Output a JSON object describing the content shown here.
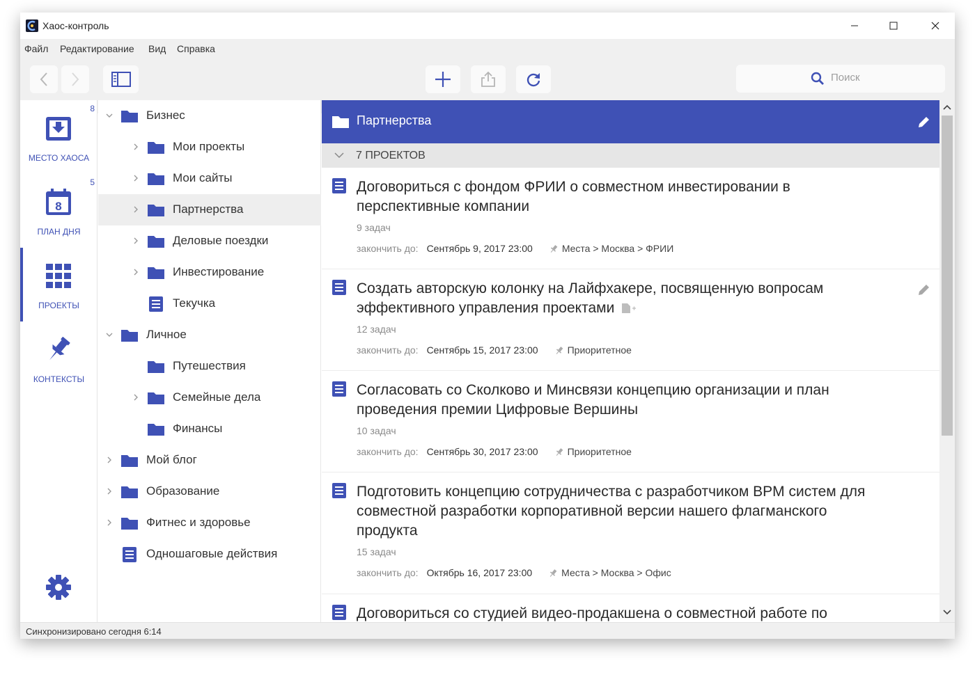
{
  "window": {
    "title": "Хаос-контроль"
  },
  "menu": [
    "Файл",
    "Редактирование",
    "Вид",
    "Справка"
  ],
  "search": {
    "placeholder": "Поиск"
  },
  "nav": {
    "chaos": {
      "label": "МЕСТО ХАОСА",
      "badge": "8"
    },
    "day": {
      "label": "ПЛАН ДНЯ",
      "badge": "5",
      "day_number": "8"
    },
    "projects": {
      "label": "ПРОЕКТЫ"
    },
    "contexts": {
      "label": "КОНТЕКСТЫ"
    }
  },
  "tree": [
    {
      "label": "Бизнес",
      "level": 0,
      "icon": "folder-icon",
      "arrow": "expanded"
    },
    {
      "label": "Мои проекты",
      "level": 1,
      "icon": "folder-icon",
      "arrow": "collapsed"
    },
    {
      "label": "Мои сайты",
      "level": 1,
      "icon": "folder-icon",
      "arrow": "collapsed"
    },
    {
      "label": "Партнерства",
      "level": 1,
      "icon": "folder-icon",
      "arrow": "collapsed",
      "selected": true
    },
    {
      "label": "Деловые поездки",
      "level": 1,
      "icon": "folder-icon",
      "arrow": "collapsed"
    },
    {
      "label": "Инвестирование",
      "level": 1,
      "icon": "folder-icon",
      "arrow": "collapsed"
    },
    {
      "label": "Текучка",
      "level": 1,
      "icon": "list-icon",
      "arrow": "none"
    },
    {
      "label": "Личное",
      "level": 0,
      "icon": "folder-icon",
      "arrow": "expanded"
    },
    {
      "label": "Путешествия",
      "level": 1,
      "icon": "folder-icon",
      "arrow": "none"
    },
    {
      "label": "Семейные дела",
      "level": 1,
      "icon": "folder-icon",
      "arrow": "collapsed"
    },
    {
      "label": "Финансы",
      "level": 1,
      "icon": "folder-icon",
      "arrow": "none"
    },
    {
      "label": "Мой блог",
      "level": 0,
      "icon": "folder-icon",
      "arrow": "collapsed"
    },
    {
      "label": "Образование",
      "level": 0,
      "icon": "folder-icon",
      "arrow": "collapsed"
    },
    {
      "label": "Фитнес и здоровье",
      "level": 0,
      "icon": "folder-icon",
      "arrow": "collapsed"
    },
    {
      "label": "Одношаговые действия",
      "level": 0,
      "icon": "list-icon",
      "arrow": "none"
    }
  ],
  "main": {
    "title": "Партнерства",
    "count": "7 ПРОЕКТОВ",
    "due_label": "закончить до:",
    "projects": [
      {
        "title": "Договориться с фондом ФРИИ о совместном инвестировании в перспективные компании",
        "tasks": "9 задач",
        "due": "Сентябрь 9, 2017 23:00",
        "context": "Места > Москва > ФРИИ"
      },
      {
        "title": "Создать авторскую колонку на Лайфхакере, посвященную вопросам эффективного управления проектами",
        "tasks": "12 задач",
        "due": "Сентябрь 15, 2017 23:00",
        "context": "Приоритетное"
      },
      {
        "title": "Согласовать со Сколково и Минсвязи концепцию организации и план проведения премии Цифровые Вершины",
        "tasks": "10 задач",
        "due": "Сентябрь 30, 2017 23:00",
        "context": "Приоритетное"
      },
      {
        "title": "Подготовить концепцию сотрудничества с разработчиком BPM систем для совместной разработки корпоративной версии нашего флагманского продукта",
        "tasks": "15 задач",
        "due": "Октябрь 16, 2017 23:00",
        "context": "Места > Москва > Офис"
      },
      {
        "title": "Договориться со студией видео-продакшена о совместной работе по"
      }
    ]
  },
  "status": "Синхронизировано сегодня 6:14",
  "colors": {
    "accent": "#3f51b5"
  }
}
